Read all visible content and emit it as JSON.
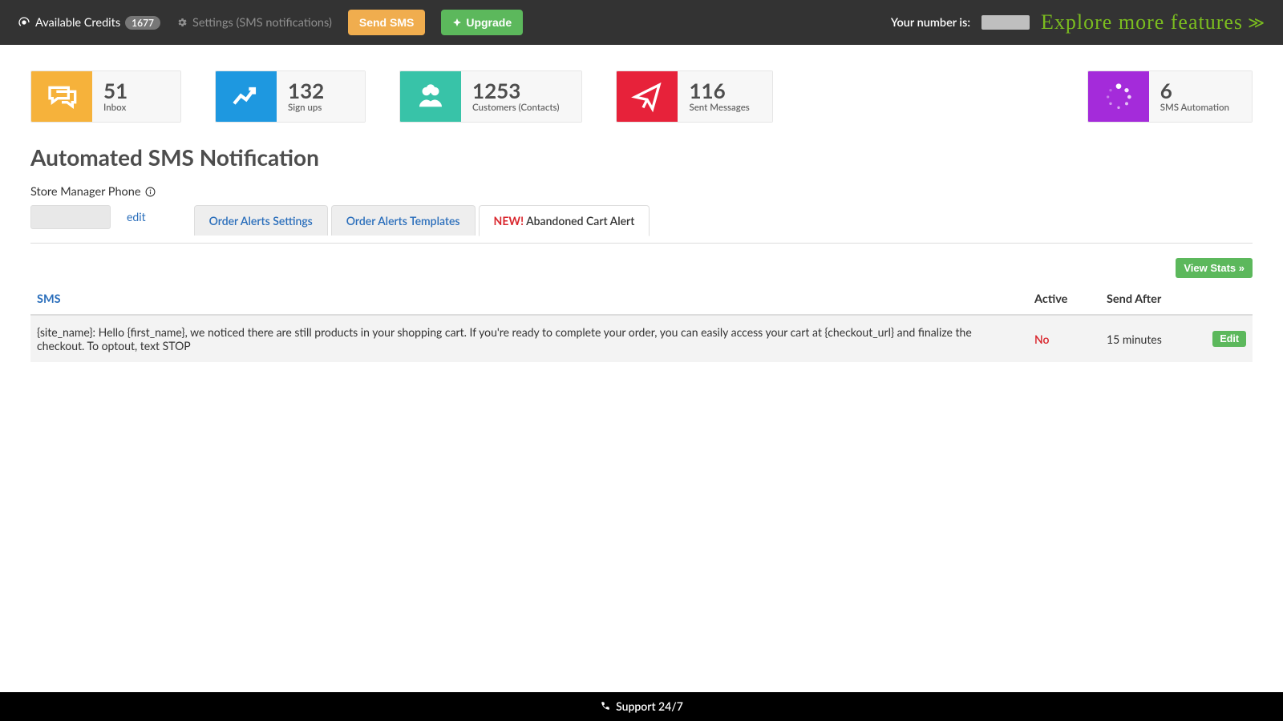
{
  "topbar": {
    "credits_label": "Available Credits",
    "credits_value": "1677",
    "settings_label": "Settings (SMS notifications)",
    "send_sms_label": "Send SMS",
    "upgrade_label": "Upgrade",
    "your_number_label": "Your number is:",
    "explore_label": "Explore more features"
  },
  "stats": [
    {
      "value": "51",
      "label": "Inbox",
      "color": "c-orange",
      "icon": "chat"
    },
    {
      "value": "132",
      "label": "Sign ups",
      "color": "c-blue",
      "icon": "chart"
    },
    {
      "value": "1253",
      "label": "Customers (Contacts)",
      "color": "c-teal",
      "icon": "users"
    },
    {
      "value": "116",
      "label": "Sent Messages",
      "color": "c-red",
      "icon": "plane"
    },
    {
      "value": "6",
      "label": "SMS Automation",
      "color": "c-purple",
      "icon": "spinner"
    }
  ],
  "page_title": "Automated SMS Notification",
  "phone": {
    "label": "Store Manager Phone",
    "edit": "edit"
  },
  "tabs": [
    {
      "label": "Order Alerts Settings",
      "active": false
    },
    {
      "label": "Order Alerts Templates",
      "active": false
    },
    {
      "new_prefix": "NEW!",
      "label": "Abandoned Cart Alert",
      "active": true
    }
  ],
  "view_stats_label": "View Stats »",
  "table": {
    "headers": {
      "sms": "SMS",
      "active": "Active",
      "send_after": "Send After",
      "actions": ""
    },
    "rows": [
      {
        "sms": "{site_name}: Hello {first_name}, we noticed there are still products in your shopping cart. If you're ready to complete your order, you can easily access your cart at {checkout_url} and finalize the checkout. To optout, text STOP",
        "active": "No",
        "send_after": "15 minutes",
        "edit": "Edit"
      }
    ]
  },
  "footer": {
    "support": "Support 24/7"
  }
}
